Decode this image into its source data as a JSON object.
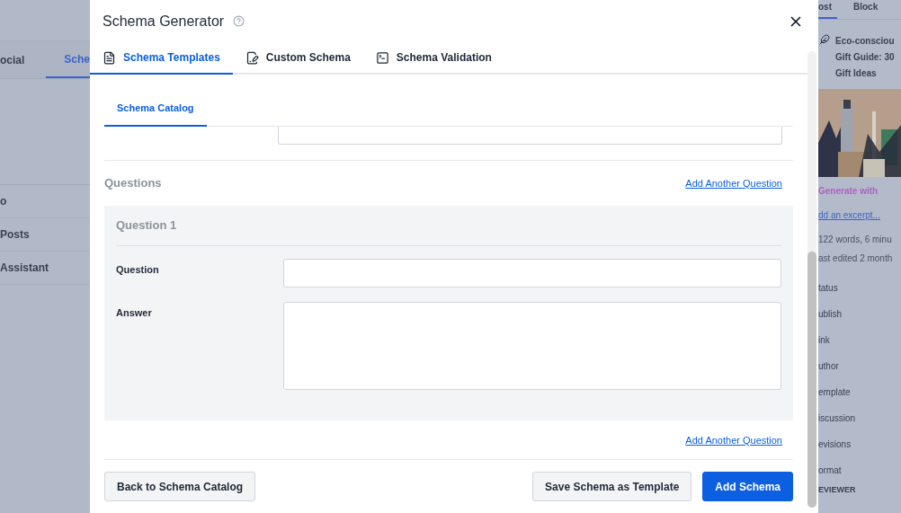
{
  "background": {
    "left": {
      "tabs": [
        {
          "label": "ocial",
          "selected": false
        },
        {
          "label": "Sche",
          "selected": true
        }
      ],
      "items": [
        "o",
        "Posts",
        "Assistant"
      ]
    },
    "right": {
      "tabs": [
        {
          "label": "ost",
          "selected": true
        },
        {
          "label": "Block",
          "selected": false
        }
      ],
      "title_lines": [
        "Eco-consciou",
        "Gift Guide: 30",
        "Gift Ideas"
      ],
      "generate": "Generate with",
      "excerpt_link": "dd an excerpt...",
      "meta": [
        "122 words, 6 minu",
        "ast edited 2 month"
      ],
      "rows": [
        "tatus",
        "ublish",
        "ink",
        "uthor",
        "emplate",
        "iscussion",
        "evisions",
        "ormat"
      ],
      "section": "EVIEWER"
    }
  },
  "dialog": {
    "title": "Schema Generator",
    "tabs": [
      {
        "label": "Schema Templates",
        "selected": true,
        "kind": "document"
      },
      {
        "label": "Custom Schema",
        "selected": false,
        "kind": "edit"
      },
      {
        "label": "Schema Validation",
        "selected": false,
        "kind": "terminal"
      }
    ],
    "subtabs": [
      {
        "label": "Schema Catalog",
        "selected": true
      }
    ],
    "section": {
      "title": "Questions",
      "link": "Add Another Question"
    },
    "questions": [
      {
        "title": "Question 1",
        "fields": [
          {
            "label": "Question",
            "kind": "input"
          },
          {
            "label": "Answer",
            "kind": "textarea"
          }
        ]
      }
    ],
    "bottom_link": "Add Another Question",
    "buttons": [
      {
        "label": "Back to Schema Catalog",
        "kind": "secondary"
      },
      {
        "label": "Save Schema as Template",
        "kind": "secondary"
      },
      {
        "label": "Add Schema",
        "kind": "primary"
      }
    ]
  }
}
